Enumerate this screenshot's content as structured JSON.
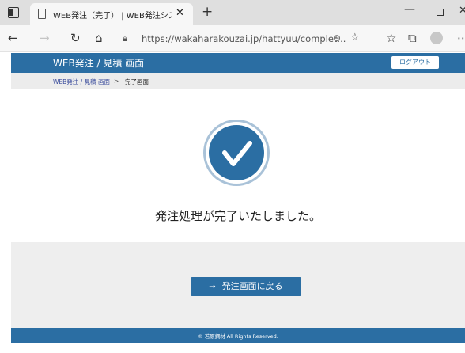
{
  "browser": {
    "tab_title": "WEB発注（完了） | WEB発注シス",
    "url_domain": "https://wakaharakouzai.jp",
    "url_path": "/hattyuu/complet...",
    "icons": [
      "window-icon",
      "page-icon",
      "close-icon",
      "plus-icon",
      "minimize-icon",
      "maximize-icon",
      "back-arrow-icon",
      "forward-arrow-icon",
      "reload-icon",
      "home-icon",
      "lock-icon",
      "zoom-icon",
      "add-favorite-icon",
      "favorites-icon",
      "collections-icon",
      "profile-avatar",
      "more-icon"
    ]
  },
  "header": {
    "title": "WEB発注 / 見積 画面",
    "logout_label": "ログアウト",
    "color": "#2b6ea3"
  },
  "breadcrumb": {
    "link": "WEB発注 / 見積 画面",
    "separator": ">",
    "current": "完了画面"
  },
  "main": {
    "message": "発注処理が完了いたしました。",
    "icon": "checkmark-icon",
    "back_button_label": "発注画面に戻る",
    "back_button_icon": "→"
  },
  "footer": {
    "copyright": "© 若原鋼材 All Rights Reserved."
  }
}
